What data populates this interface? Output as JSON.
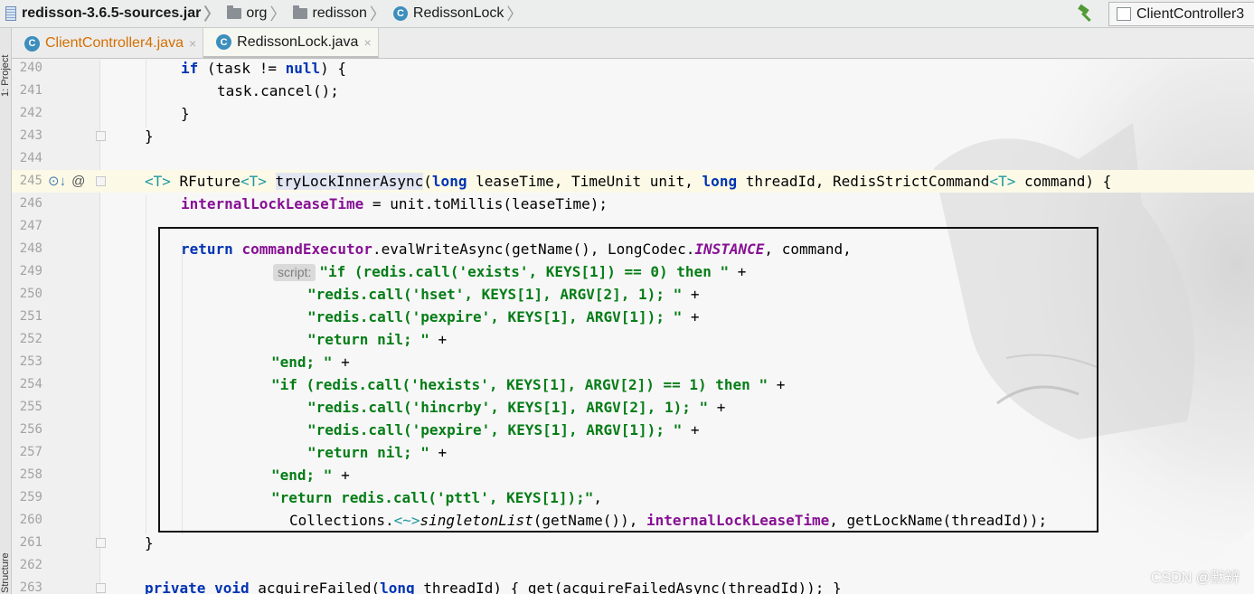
{
  "breadcrumb": {
    "items": [
      {
        "label": "redisson-3.6.5-sources.jar",
        "icon": "jar-icon"
      },
      {
        "label": "org",
        "icon": "folder-icon"
      },
      {
        "label": "redisson",
        "icon": "folder-icon"
      },
      {
        "label": "RedissonLock",
        "icon": "class-icon"
      }
    ],
    "separator": "〉"
  },
  "toolbar": {
    "build_icon": "hammer-icon",
    "run_config": "ClientController3"
  },
  "toolstrip": {
    "project_label": "1: Project",
    "structure_label": "Structure"
  },
  "tabs": [
    {
      "label": "ClientController4.java",
      "icon_letter": "C",
      "close": "×",
      "active": false
    },
    {
      "label": "RedissonLock.java",
      "icon_letter": "C",
      "close": "×",
      "active": true
    }
  ],
  "editor": {
    "line_numbers": [
      "240",
      "241",
      "242",
      "243",
      "244",
      "245",
      "246",
      "247",
      "248",
      "249",
      "250",
      "251",
      "252",
      "253",
      "254",
      "255",
      "256",
      "257",
      "258",
      "259",
      "260",
      "261",
      "262",
      "263"
    ],
    "current_line": "245",
    "inlay_hint": "script:",
    "gutter_markers": [
      "override-icon",
      "annotation-icon"
    ],
    "accent_color": "#0033b3"
  },
  "watermark": "CSDN @默辨"
}
